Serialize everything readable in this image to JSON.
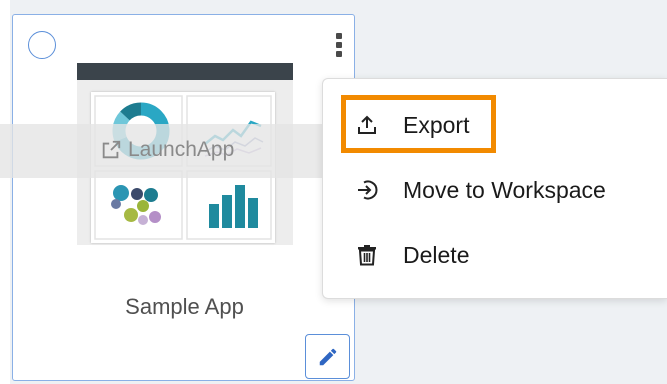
{
  "card": {
    "app_name": "Sample App",
    "launch_label": "LaunchApp"
  },
  "menu": {
    "items": [
      {
        "label": "Export",
        "icon": "upload-icon"
      },
      {
        "label": "Move to Workspace",
        "icon": "move-arrow-icon"
      },
      {
        "label": "Delete",
        "icon": "trash-icon"
      }
    ]
  },
  "colors": {
    "card_border": "#8ab0e6",
    "accent": "#5b8fd9",
    "highlight": "#f28a00",
    "donut_blue": "#2aa7c4",
    "chart_teal": "#1f8a9e"
  }
}
